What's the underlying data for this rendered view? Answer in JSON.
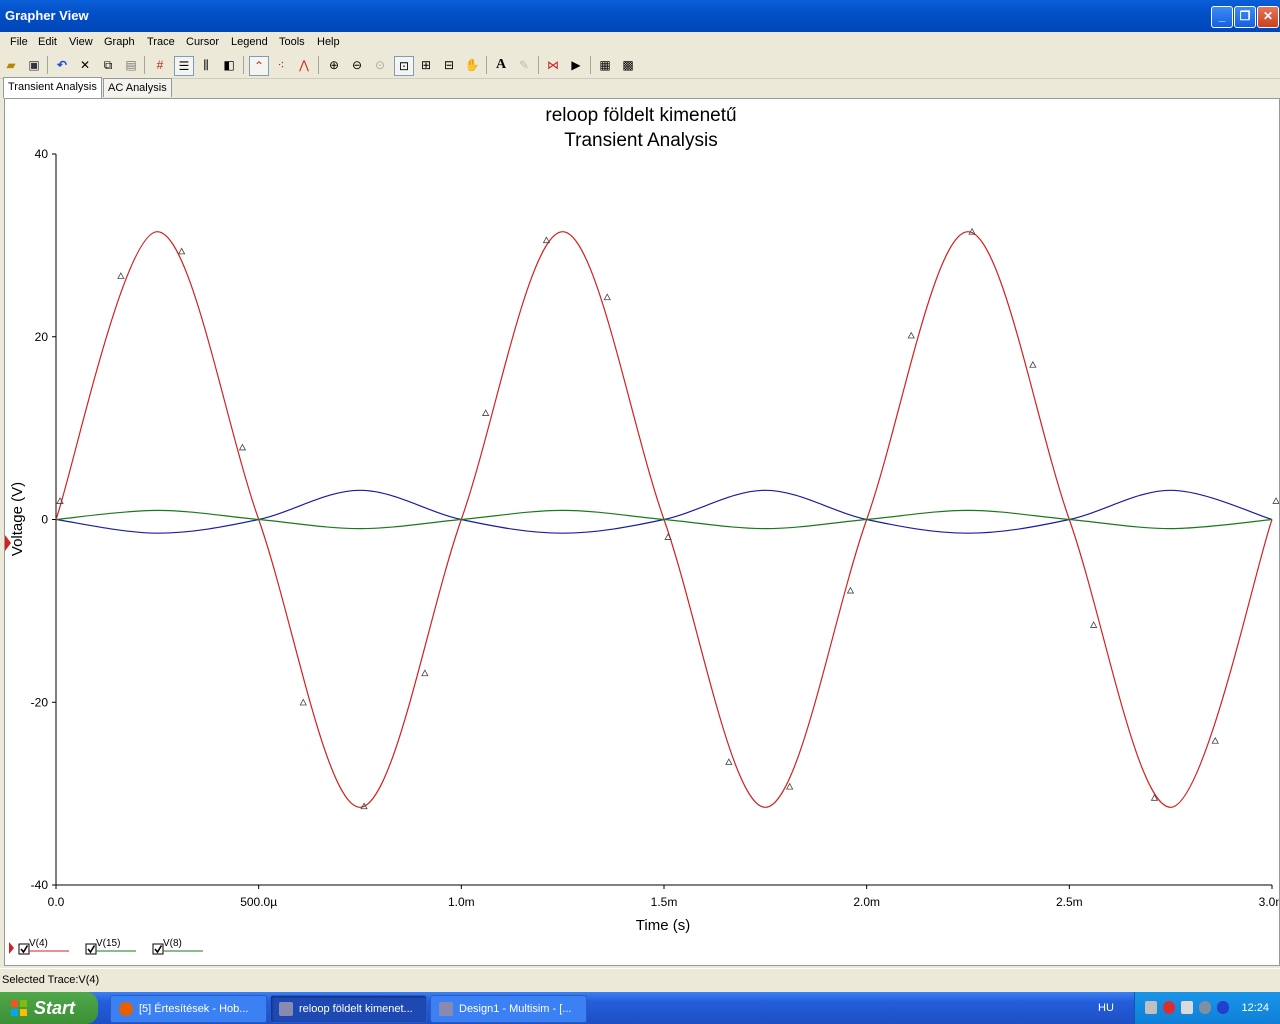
{
  "window": {
    "title": "Grapher View"
  },
  "menu": [
    "File",
    "Edit",
    "View",
    "Graph",
    "Trace",
    "Cursor",
    "Legend",
    "Tools",
    "Help"
  ],
  "toolbar_icons": [
    "open-icon",
    "save-icon",
    "undo-icon",
    "cut-icon",
    "copy-icon",
    "paste-icon",
    "grid-icon",
    "legend-icon",
    "cursors-icon",
    "overlay-icon",
    "line-trace-icon",
    "dots-trace-icon",
    "line-dots-icon",
    "zoom-in-icon",
    "zoom-out-icon",
    "zoom-full-icon",
    "zoom-box-icon",
    "zoom-x-icon",
    "zoom-y-icon",
    "pan-icon",
    "text-icon",
    "disabled-text-icon",
    "export-icon",
    "properties-icon",
    "print-icon",
    "print-preview-icon"
  ],
  "tabs": [
    {
      "label": "Transient Analysis",
      "active": true
    },
    {
      "label": "AC Analysis",
      "active": false
    }
  ],
  "chart_data": {
    "type": "line",
    "title": "reloop földelt kimenetű",
    "subtitle": "Transient Analysis",
    "xlabel": "Time (s)",
    "ylabel": "Voltage (V)",
    "xlim": [
      0,
      0.003
    ],
    "ylim": [
      -40,
      40
    ],
    "x_ticks": [
      {
        "value": 0,
        "label": "0.0"
      },
      {
        "value": 0.0005,
        "label": "500.0µ"
      },
      {
        "value": 0.001,
        "label": "1.0m"
      },
      {
        "value": 0.0015,
        "label": "1.5m"
      },
      {
        "value": 0.002,
        "label": "2.0m"
      },
      {
        "value": 0.0025,
        "label": "2.5m"
      },
      {
        "value": 0.003,
        "label": "3.0m"
      }
    ],
    "y_ticks": [
      {
        "value": 40,
        "label": "40"
      },
      {
        "value": 20,
        "label": "20"
      },
      {
        "value": 0,
        "label": "0"
      },
      {
        "value": -20,
        "label": "-20"
      },
      {
        "value": -40,
        "label": "-40"
      }
    ],
    "grid": false,
    "legend_position": "bottom-left",
    "series": [
      {
        "name": "V(4)",
        "color": "#d42020",
        "markers": true,
        "points": [
          [
            0,
            0
          ],
          [
            0.00025,
            31.5
          ],
          [
            0.0005,
            0
          ],
          [
            0.00075,
            -31.5
          ],
          [
            0.001,
            0
          ],
          [
            0.00125,
            31.5
          ],
          [
            0.0015,
            0
          ],
          [
            0.00175,
            -31.5
          ],
          [
            0.002,
            0
          ],
          [
            0.00225,
            31.5
          ],
          [
            0.0025,
            0
          ],
          [
            0.00275,
            -31.5
          ],
          [
            0.003,
            0
          ]
        ]
      },
      {
        "name": "V(15)",
        "color": "#1a1aa8",
        "markers": false,
        "points": [
          [
            0,
            0
          ],
          [
            0.00025,
            -1.5
          ],
          [
            0.0005,
            0
          ],
          [
            0.00075,
            3.2
          ],
          [
            0.001,
            0
          ],
          [
            0.00125,
            -1.5
          ],
          [
            0.0015,
            0
          ],
          [
            0.00175,
            3.2
          ],
          [
            0.002,
            0
          ],
          [
            0.00225,
            -1.5
          ],
          [
            0.0025,
            0
          ],
          [
            0.00275,
            3.2
          ],
          [
            0.003,
            0
          ]
        ]
      },
      {
        "name": "V(8)",
        "color": "#1a7a1a",
        "markers": false,
        "points": [
          [
            0,
            0
          ],
          [
            0.00025,
            1
          ],
          [
            0.0005,
            0
          ],
          [
            0.00075,
            -1
          ],
          [
            0.001,
            0
          ],
          [
            0.00125,
            1
          ],
          [
            0.0015,
            0
          ],
          [
            0.00175,
            -1
          ],
          [
            0.002,
            0
          ],
          [
            0.00225,
            1
          ],
          [
            0.0025,
            0
          ],
          [
            0.00275,
            -1
          ],
          [
            0.003,
            0
          ]
        ]
      }
    ]
  },
  "legend": [
    {
      "label": "V(4)",
      "checked": true,
      "color": "#d42020"
    },
    {
      "label": "V(15)",
      "checked": true,
      "color": "#1a7a1a"
    },
    {
      "label": "V(8)",
      "checked": true,
      "color": "#1a7a1a"
    }
  ],
  "status": {
    "text": "Selected Trace:V(4)"
  },
  "taskbar": {
    "start_label": "Start",
    "tasks": [
      {
        "label": "[5] Értesítések - Hob...",
        "active": false
      },
      {
        "label": "reloop földelt kimenet...",
        "active": true
      },
      {
        "label": "Design1 - Multisim - [...",
        "active": false
      }
    ],
    "language": "HU",
    "clock": "12:24"
  }
}
